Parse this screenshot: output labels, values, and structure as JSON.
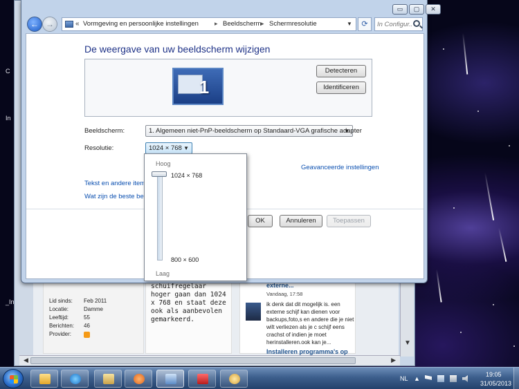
{
  "window": {
    "breadcrumb_chevron": "«",
    "breadcrumbs": [
      "Vormgeving en persoonlijke instellingen",
      "Beeldscherm",
      "Schermresolutie"
    ],
    "search_placeholder": "In Configur...",
    "title_buttons": {
      "minimize": "▭",
      "maximize": "▢",
      "close": "✕"
    }
  },
  "display_settings": {
    "title": "De weergave van uw beeldscherm wijzigen",
    "monitor_number": "1",
    "detect_button": "Detecteren",
    "identify_button": "Identificeren",
    "display_label": "Beeldscherm:",
    "display_value": "1. Algemeen niet-PnP-beeldscherm op Standaard-VGA grafische adapter",
    "resolution_label": "Resolutie:",
    "resolution_value": "1024 × 768",
    "advanced_link": "Geavanceerde instellingen",
    "text_link": "Tekst en andere items g",
    "best_link": "Wat zijn de beste beeld",
    "ok_button": "OK",
    "cancel_button": "Annuleren",
    "apply_button": "Toepassen"
  },
  "resolution_popup": {
    "high_label": "Hoog",
    "low_label": "Laag",
    "top_option": "1024 × 768",
    "bottom_option": "800 × 600",
    "slider_level": 1.0
  },
  "background_page": {
    "left_texts": [
      "C",
      "In",
      "_Ins"
    ],
    "profile": [
      {
        "label": "Lid sinds:",
        "value": "Feb 2011"
      },
      {
        "label": "Locatie:",
        "value": "Damme"
      },
      {
        "label": "Leeftijd:",
        "value": "55"
      },
      {
        "label": "Berichten:",
        "value": "46"
      },
      {
        "label": "Provider:",
        "value": ""
      }
    ],
    "post_text": "schuifregelaar hoger gaan dan 1024 x 768 en staat deze ook als aanbevolen gemarkeerd.",
    "news_title": "externe...",
    "news_date": "Vandaag, 17:58",
    "news_body": "ik denk dat dit mogelijk is. een externe schijf kan dienen voor backups,foto,s en andere die je niet wilt verliezen als je c schijf eens crachst of indien je moet herinstalleren.ook kan je...",
    "news_link": "Installeren programma's op"
  },
  "taskbar": {
    "language": "NL",
    "time": "19:05",
    "date": "31/05/2013"
  },
  "colors": {
    "title_blue": "#1e3287",
    "link_blue": "#0a4fb0",
    "taskbar": "#3d5f8d"
  }
}
